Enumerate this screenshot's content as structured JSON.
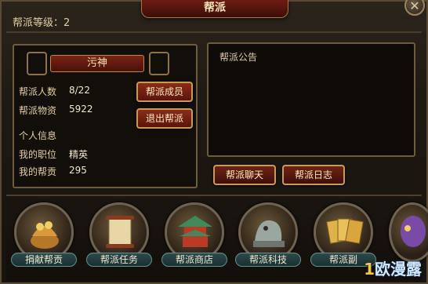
{
  "window": {
    "title": "帮派",
    "close_icon": "close-icon",
    "level_text": "帮派等级：2"
  },
  "info": {
    "guild_name": "污神",
    "members_label": "帮派人数",
    "members_value": "8/22",
    "resources_label": "帮派物资",
    "resources_value": "5922",
    "personal_header": "个人信息",
    "position_label": "我的职位",
    "position_value": "精英",
    "contribution_label": "我的帮贡",
    "contribution_value": "295"
  },
  "buttons": {
    "members": "帮派成员",
    "leave": "退出帮派",
    "chat": "帮派聊天",
    "log": "帮派日志"
  },
  "notice": {
    "title": "帮派公告"
  },
  "features": [
    {
      "label": "捐献帮贡",
      "icon": "treasure-pot-icon"
    },
    {
      "label": "帮派任务",
      "icon": "scroll-icon"
    },
    {
      "label": "帮派商店",
      "icon": "pagoda-icon"
    },
    {
      "label": "帮派科技",
      "icon": "dragon-statue-icon"
    },
    {
      "label": "帮派副",
      "icon": "cards-icon"
    },
    {
      "label": "",
      "icon": "mask-icon"
    }
  ],
  "watermark": {
    "number": "1",
    "text": "欧漫露"
  }
}
